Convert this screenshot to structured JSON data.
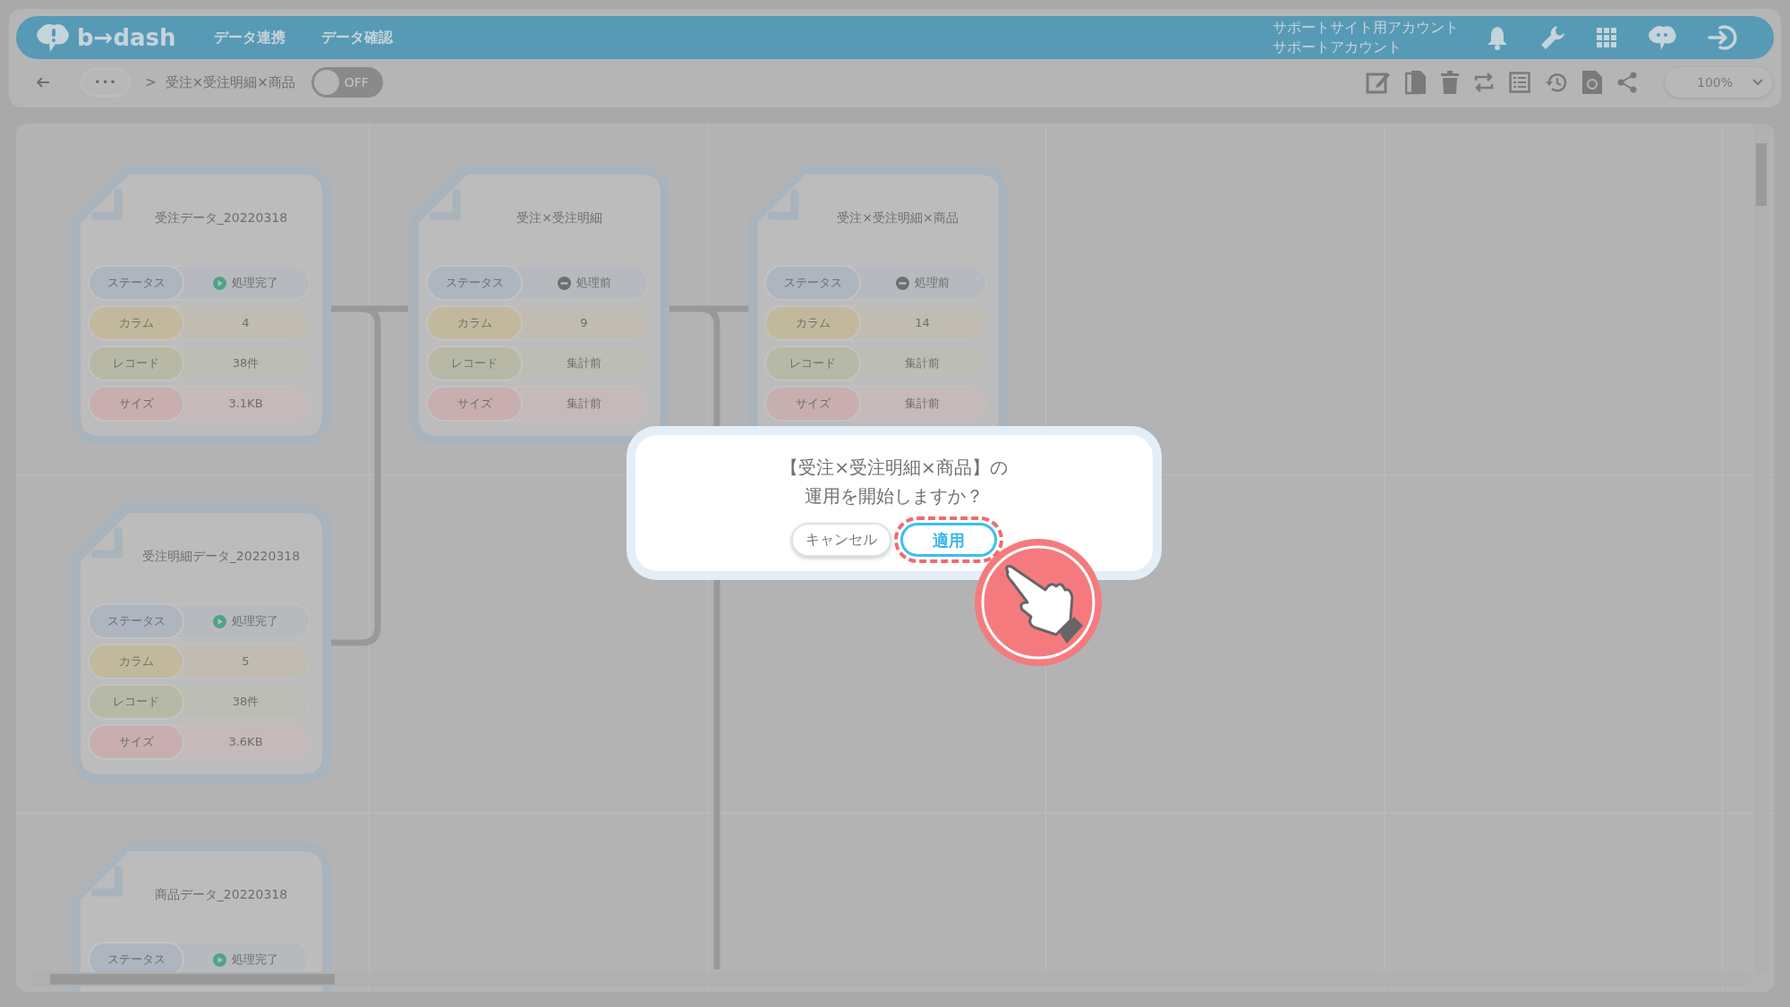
{
  "header": {
    "logo": "b→dash",
    "nav": [
      "データ連携",
      "データ確認"
    ],
    "account": [
      "サポートサイト用アカウント",
      "サポートアカウント"
    ]
  },
  "toolbar": {
    "more": "•••",
    "separator": ">",
    "title": "受注×受注明細×商品",
    "toggle": {
      "label": "OFF",
      "on": false
    },
    "zoom": "100%"
  },
  "cards": [
    {
      "title": "受注データ_20220318",
      "rows": [
        {
          "kind": "status",
          "label": "ステータス",
          "value": "処理完了",
          "complete": true
        },
        {
          "kind": "columns",
          "label": "カラム",
          "value": "4"
        },
        {
          "kind": "records",
          "label": "レコード",
          "value": "38件"
        },
        {
          "kind": "size",
          "label": "サイズ",
          "value": "3.1KB"
        }
      ]
    },
    {
      "title": "受注×受注明細",
      "rows": [
        {
          "kind": "status",
          "label": "ステータス",
          "value": "処理前",
          "complete": false
        },
        {
          "kind": "columns",
          "label": "カラム",
          "value": "9"
        },
        {
          "kind": "records",
          "label": "レコード",
          "value": "集計前"
        },
        {
          "kind": "size",
          "label": "サイズ",
          "value": "集計前"
        }
      ]
    },
    {
      "title": "受注×受注明細×商品",
      "rows": [
        {
          "kind": "status",
          "label": "ステータス",
          "value": "処理前",
          "complete": false
        },
        {
          "kind": "columns",
          "label": "カラム",
          "value": "14"
        },
        {
          "kind": "records",
          "label": "レコード",
          "value": "集計前"
        },
        {
          "kind": "size",
          "label": "サイズ",
          "value": "集計前"
        }
      ]
    },
    {
      "title": "受注明細データ_20220318",
      "rows": [
        {
          "kind": "status",
          "label": "ステータス",
          "value": "処理完了",
          "complete": true
        },
        {
          "kind": "columns",
          "label": "カラム",
          "value": "5"
        },
        {
          "kind": "records",
          "label": "レコード",
          "value": "38件"
        },
        {
          "kind": "size",
          "label": "サイズ",
          "value": "3.6KB"
        }
      ]
    },
    {
      "title": "商品データ_20220318",
      "rows": [
        {
          "kind": "status",
          "label": "ステータス",
          "value": "処理完了",
          "complete": true
        }
      ]
    }
  ],
  "dialog": {
    "message": [
      "【受注×受注明細×商品】の",
      "運用を開始しますか？"
    ],
    "buttons": [
      {
        "kind": "cancel",
        "label": "キャンセル",
        "highlighted": false
      },
      {
        "kind": "apply",
        "label": "適用",
        "highlighted": true
      }
    ]
  }
}
